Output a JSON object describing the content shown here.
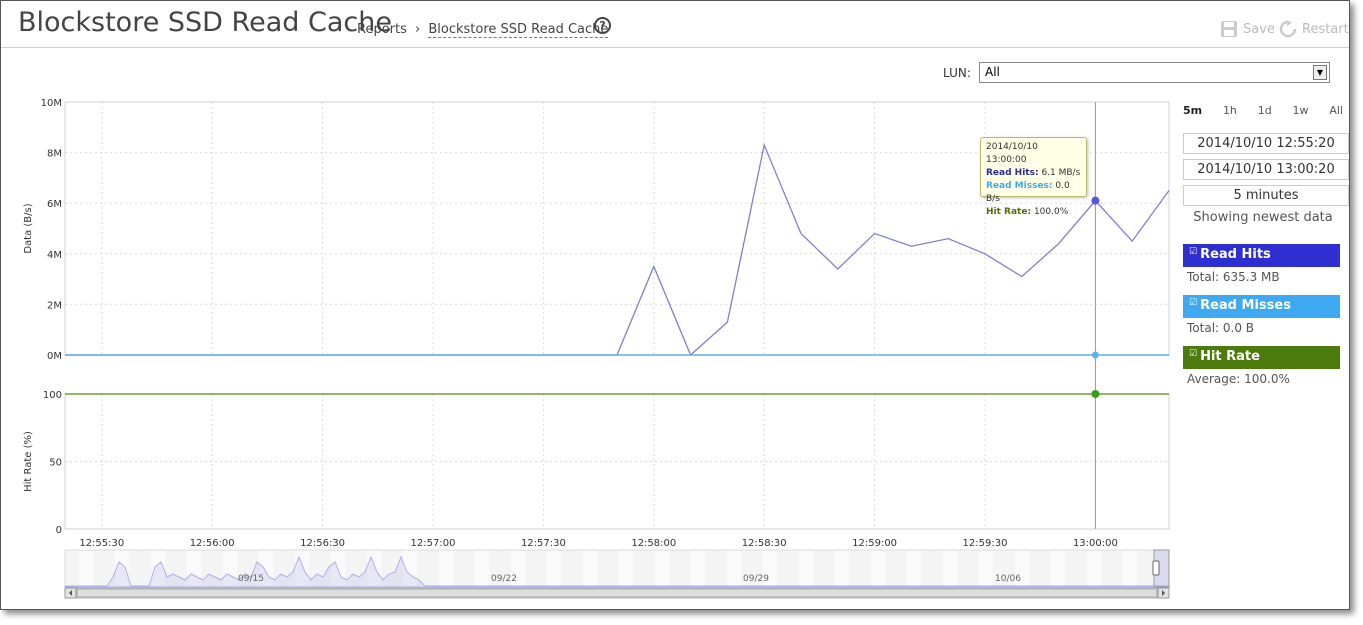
{
  "header": {
    "title": "Blockstore SSD Read Cache",
    "breadcrumb_parent": "Reports",
    "breadcrumb_separator": "›",
    "breadcrumb_current": "Blockstore SSD Read Cache",
    "help_icon": "?",
    "save_label": "Save",
    "restart_label": "Restart"
  },
  "filter": {
    "lun_label": "LUN:",
    "lun_value": "All"
  },
  "time_controls": {
    "ranges": [
      "5m",
      "1h",
      "1d",
      "1w",
      "All"
    ],
    "active_range": "5m",
    "start": "2014/10/10 12:55:20",
    "end": "2014/10/10 13:00:20",
    "duration": "5 minutes",
    "status": "Showing newest data"
  },
  "legend": [
    {
      "name": "Read Hits",
      "summary": "Total: 635.3 MB",
      "color": "#2f2fd1"
    },
    {
      "name": "Read Misses",
      "summary": "Total: 0.0 B",
      "color": "#3ea9f0"
    },
    {
      "name": "Hit Rate",
      "summary": "Average: 100.0%",
      "color": "#4c7a0d"
    }
  ],
  "tooltip": {
    "time": "2014/10/10 13:00:00",
    "read_hits_label": "Read Hits:",
    "read_hits_value": "6.1 MB/s",
    "read_misses_label": "Read Misses:",
    "read_misses_value": "0.0 B/s",
    "hit_rate_label": "Hit Rate:",
    "hit_rate_value": "100.0%"
  },
  "colors": {
    "read_hits_line": "#7f7fd5",
    "read_misses_line": "#5ab2ee",
    "hit_rate_line": "#4f8a10",
    "tooltip_read_hits": "#2b2b9c",
    "tooltip_read_misses": "#3ea9f0",
    "tooltip_hit_rate": "#556b10"
  },
  "chart_data": [
    {
      "type": "line",
      "ylabel": "Data (B/s)",
      "ylim": [
        0,
        10000000
      ],
      "yticks": [
        "0M",
        "2M",
        "4M",
        "6M",
        "8M",
        "10M"
      ],
      "x_ticks": [
        "12:55:30",
        "12:56:00",
        "12:56:30",
        "12:57:00",
        "12:57:30",
        "12:58:00",
        "12:58:30",
        "12:59:00",
        "12:59:30",
        "13:00:00"
      ],
      "grid": true,
      "series": [
        {
          "name": "Read Hits",
          "x": [
            "12:55:20",
            "12:57:50",
            "12:58:00",
            "12:58:10",
            "12:58:20",
            "12:58:30",
            "12:58:40",
            "12:58:50",
            "12:59:00",
            "12:59:10",
            "12:59:20",
            "12:59:30",
            "12:59:40",
            "12:59:50",
            "13:00:00",
            "13:00:10",
            "13:00:20"
          ],
          "values": [
            0,
            0,
            3500000,
            0,
            1300000,
            8300000,
            4800000,
            3400000,
            4800000,
            4300000,
            4600000,
            4000000,
            3100000,
            4400000,
            6100000,
            4500000,
            6500000
          ]
        },
        {
          "name": "Read Misses",
          "x": [
            "12:55:20",
            "13:00:20"
          ],
          "values": [
            0,
            0
          ]
        }
      ]
    },
    {
      "type": "line",
      "ylabel": "Hit Rate (%)",
      "ylim": [
        0,
        100
      ],
      "yticks": [
        "0",
        "50",
        "100"
      ],
      "x_ticks": [
        "12:55:30",
        "12:56:00",
        "12:56:30",
        "12:57:00",
        "12:57:30",
        "12:58:00",
        "12:58:30",
        "12:59:00",
        "12:59:30",
        "13:00:00"
      ],
      "grid": true,
      "series": [
        {
          "name": "Hit Rate",
          "x": [
            "12:55:20",
            "13:00:20"
          ],
          "values": [
            100,
            100
          ]
        }
      ]
    }
  ],
  "navigator": {
    "dates": [
      "09/15",
      "09/22",
      "09/29",
      "10/06"
    ]
  }
}
